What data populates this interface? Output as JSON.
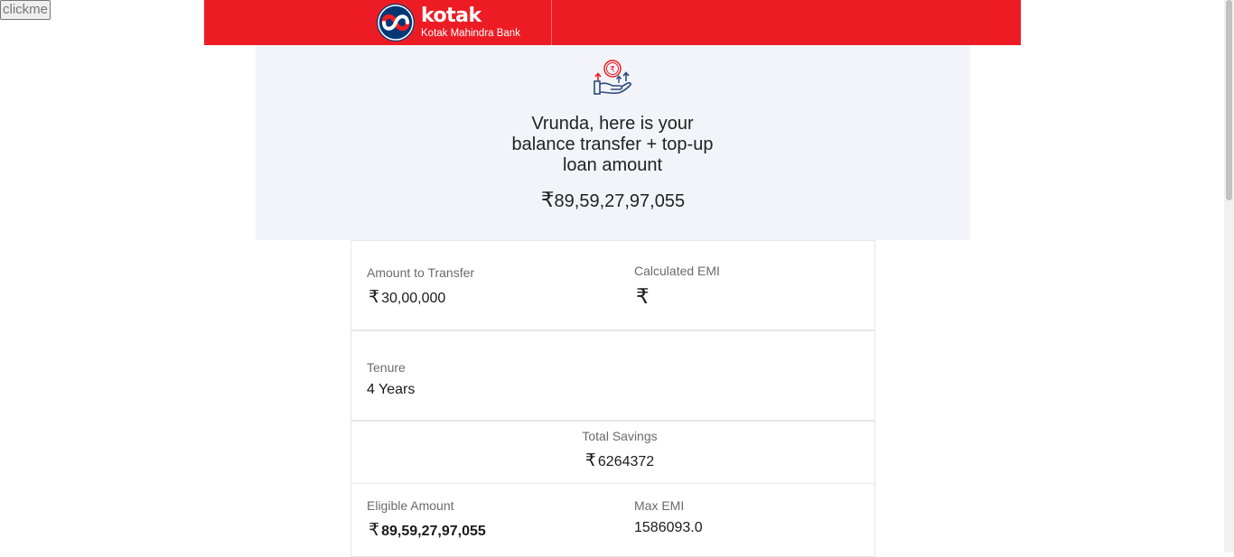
{
  "debug_button": {
    "label": "clickme"
  },
  "header": {
    "brand": "kotak",
    "subbrand": "Kotak Mahindra Bank",
    "color": "#ed1c24"
  },
  "hero": {
    "icon": "rupee-hand-growth-icon",
    "title_line1": "Vrunda, here is your",
    "title_line2": "balance transfer + top-up",
    "title_line3": "loan amount",
    "currency": "₹",
    "amount": "89,59,27,97,055"
  },
  "summary": {
    "amount_to_transfer": {
      "label": "Amount to Transfer",
      "currency": "₹",
      "value": "30,00,000"
    },
    "calculated_emi": {
      "label": "Calculated EMI",
      "currency": "₹",
      "value": ""
    },
    "tenure": {
      "label": "Tenure",
      "value": "4 Years"
    },
    "total_savings": {
      "label": "Total Savings",
      "currency": "₹",
      "value": "6264372"
    },
    "eligible_amount": {
      "label": "Eligible Amount",
      "currency": "₹",
      "value": "89,59,27,97,055"
    },
    "max_emi": {
      "label": "Max EMI",
      "value": "1586093.0"
    }
  }
}
